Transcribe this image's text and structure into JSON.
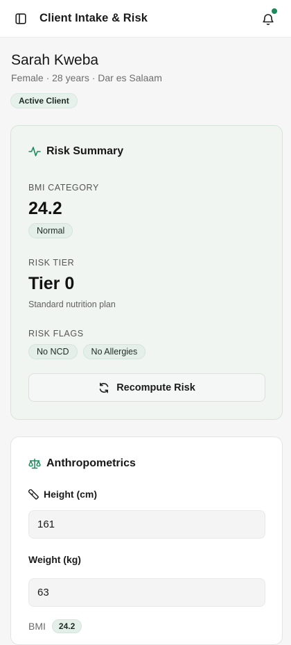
{
  "header": {
    "title": "Client Intake & Risk",
    "sidebar_icon": "sidebar-panel-icon",
    "bell_icon": "bell-icon",
    "notification_dot_color": "#1b8a5a"
  },
  "client": {
    "name": "Sarah Kweba",
    "meta": "Female · 28 years · Dar es Salaam",
    "status_badge": "Active Client"
  },
  "risk_summary": {
    "title": "Risk Summary",
    "icon": "activity-pulse-icon",
    "bmi_category_label": "BMI CATEGORY",
    "bmi_value": "24.2",
    "bmi_category": "Normal",
    "risk_tier_label": "RISK TIER",
    "risk_tier_value": "Tier 0",
    "risk_tier_note": "Standard nutrition plan",
    "risk_flags_label": "RISK FLAGS",
    "risk_flags": [
      "No NCD",
      "No Allergies"
    ],
    "recompute_label": "Recompute Risk",
    "recompute_icon": "refresh-icon"
  },
  "anthropometrics": {
    "title": "Anthropometrics",
    "icon": "scale-balance-icon",
    "height_label": "Height (cm)",
    "height_icon": "ruler-icon",
    "height_value": "161",
    "weight_label": "Weight (kg)",
    "weight_value": "63",
    "bmi_label": "BMI",
    "bmi_value": "24.2"
  },
  "colors": {
    "accent": "#1b8a5a",
    "card_tint": "#f1f5f2",
    "pill_bg": "#e4efe9"
  }
}
